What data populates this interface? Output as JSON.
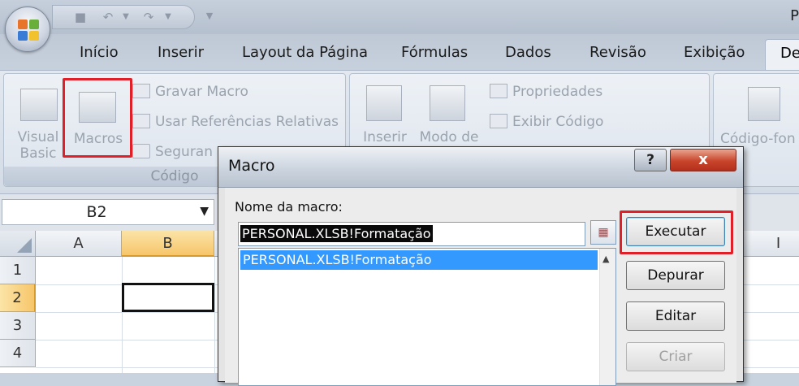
{
  "app_title": "P",
  "tabs": [
    "Início",
    "Inserir",
    "Layout da Página",
    "Fórmulas",
    "Dados",
    "Revisão",
    "Exibição"
  ],
  "active_tab": "De",
  "ribbon": {
    "code_group": {
      "label": "Código",
      "visual_basic": "Visual\nBasic",
      "macros": "Macros",
      "record_macro": "Gravar Macro",
      "relative_refs": "Usar Referências Relativas",
      "security": "Seguran"
    },
    "controls_group": {
      "insert": "Inserir",
      "design_mode": "Modo de",
      "properties": "Propriedades",
      "view_code": "Exibir Código"
    },
    "source_group": {
      "source": "Código-fon"
    }
  },
  "name_box": "B2",
  "columns": [
    "A",
    "B",
    "I"
  ],
  "rows": [
    "1",
    "2",
    "3",
    "4"
  ],
  "dialog": {
    "title": "Macro",
    "help": "?",
    "close": "x",
    "name_label": "Nome da macro:",
    "name_value": "PERSONAL.XLSB!Formatação",
    "list_items": [
      "PERSONAL.XLSB!Formatação"
    ],
    "buttons": {
      "run": "Executar",
      "debug": "Depurar",
      "edit": "Editar",
      "create": "Criar"
    }
  },
  "colors": {
    "highlight": "#e01f28",
    "selection": "#3399ff",
    "selected_header": "#f7c66a"
  }
}
